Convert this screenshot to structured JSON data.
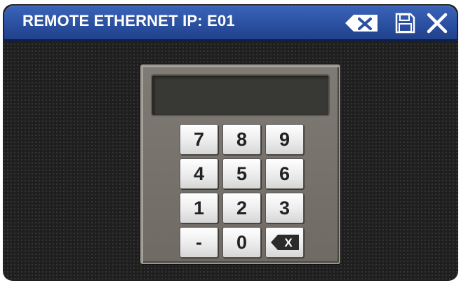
{
  "header": {
    "title": "REMOTE ETHERNET IP: E01",
    "clear_icon": "backspace-x-icon",
    "save_icon": "floppy-save-icon",
    "close_icon": "close-x-icon"
  },
  "keypad": {
    "display_value": "",
    "keys": {
      "k7": "7",
      "k8": "8",
      "k9": "9",
      "k4": "4",
      "k5": "5",
      "k6": "6",
      "k1": "1",
      "k2": "2",
      "k3": "3",
      "dash": "-",
      "k0": "0",
      "backspace_icon": "backspace-icon",
      "backspace_label": "X"
    }
  },
  "colors": {
    "titlebar": "#2a4f9f",
    "panel": "#77736c",
    "display": "#383835",
    "key": "#f0f0f0"
  }
}
